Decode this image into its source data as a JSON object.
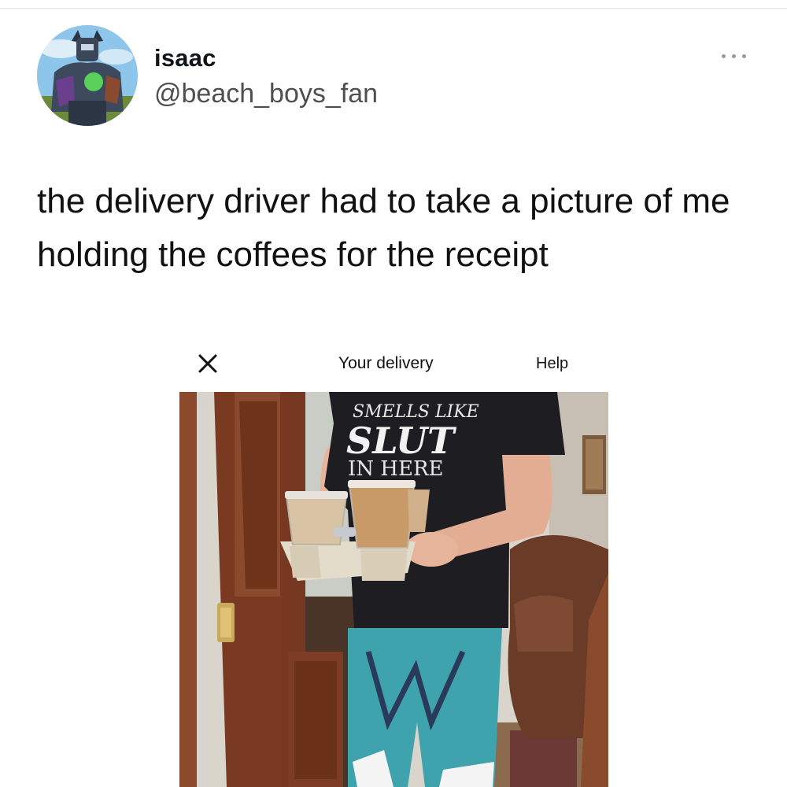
{
  "tweet": {
    "author_name": "isaac",
    "author_handle": "@beach_boys_fan",
    "text": "the delivery driver had to take a picture of me holding the coffees for the receipt"
  },
  "receipt": {
    "title": "Your delivery",
    "help_label": "Help",
    "shirt_text": [
      "SMELLS LIKE",
      "SLUT",
      "IN HERE"
    ]
  },
  "icons": {
    "more": "more-dots-icon",
    "close": "close-x-icon"
  },
  "colors": {
    "text": "#0f1419",
    "handle": "#4f4f4f",
    "shorts": "#3fa3ad",
    "door": "#7a3a22"
  }
}
